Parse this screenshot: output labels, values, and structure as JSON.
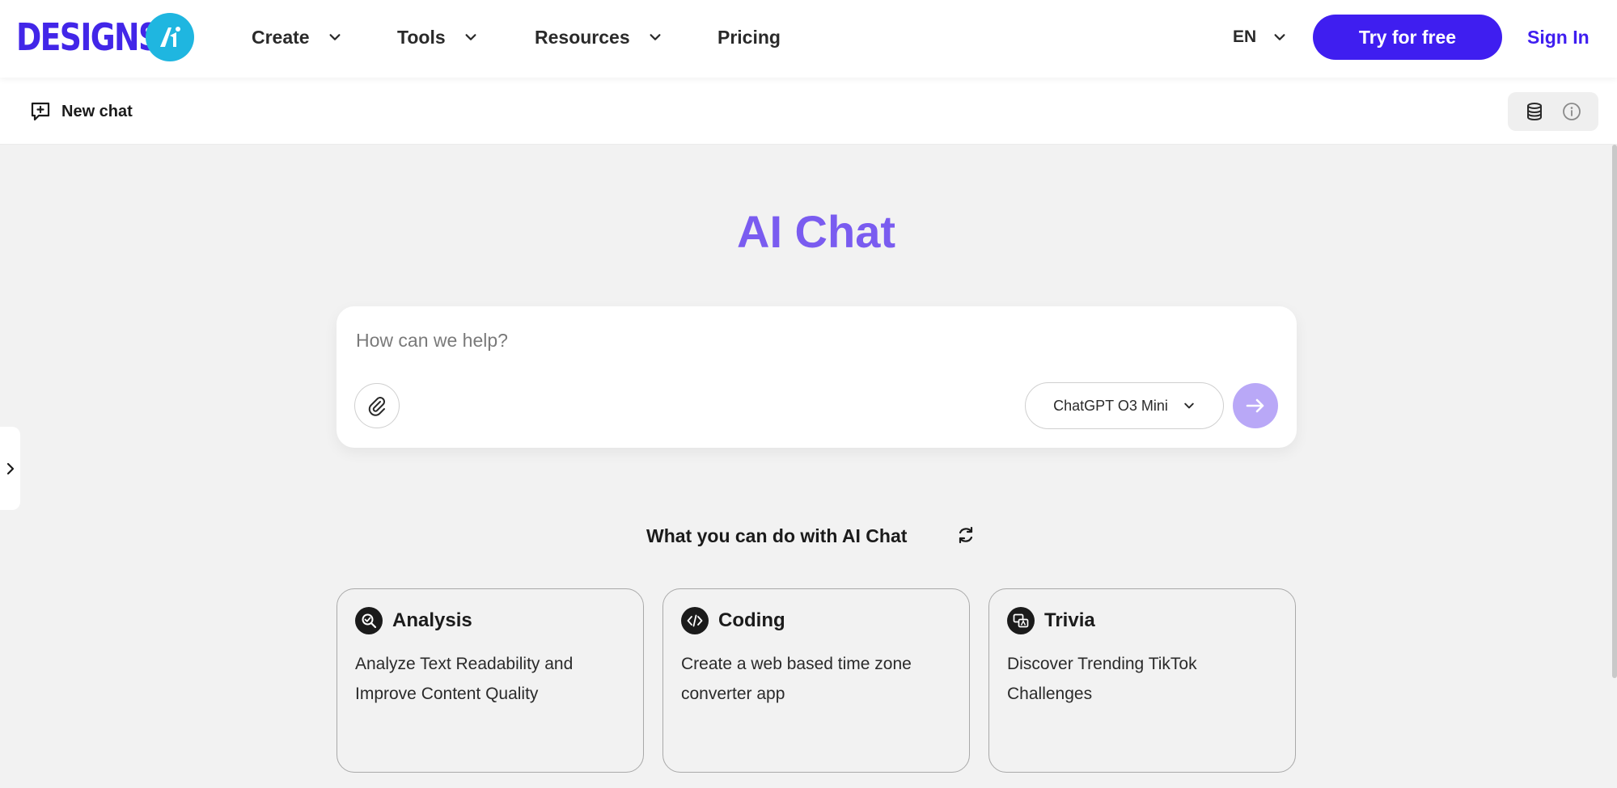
{
  "brand": {
    "logo_text": "DESIGNS.",
    "accent": "#3f1ef0",
    "logo_color": "#4226e8",
    "logo_badge_color": "#1fb6e0"
  },
  "nav": {
    "items": [
      {
        "label": "Create",
        "has_dropdown": true
      },
      {
        "label": "Tools",
        "has_dropdown": true
      },
      {
        "label": "Resources",
        "has_dropdown": true
      },
      {
        "label": "Pricing",
        "has_dropdown": false
      }
    ],
    "language": "EN",
    "try_label": "Try for free",
    "signin_label": "Sign In"
  },
  "subbar": {
    "new_chat_label": "New chat",
    "icons": [
      "database-icon",
      "info-icon"
    ]
  },
  "main": {
    "title": "AI Chat",
    "title_color": "#7a5cf0",
    "input_placeholder": "How can we help?",
    "model_label": "ChatGPT O3 Mini",
    "send_color": "#b9a8f7",
    "suggest_heading": "What you can do with AI Chat",
    "cards": [
      {
        "title": "Analysis",
        "desc": "Analyze Text Readability and Improve Content Quality",
        "icon": "analysis-icon"
      },
      {
        "title": "Coding",
        "desc": "Create a web based time zone converter app",
        "icon": "code-icon"
      },
      {
        "title": "Trivia",
        "desc": "Discover Trending TikTok Challenges",
        "icon": "trivia-icon"
      }
    ]
  }
}
